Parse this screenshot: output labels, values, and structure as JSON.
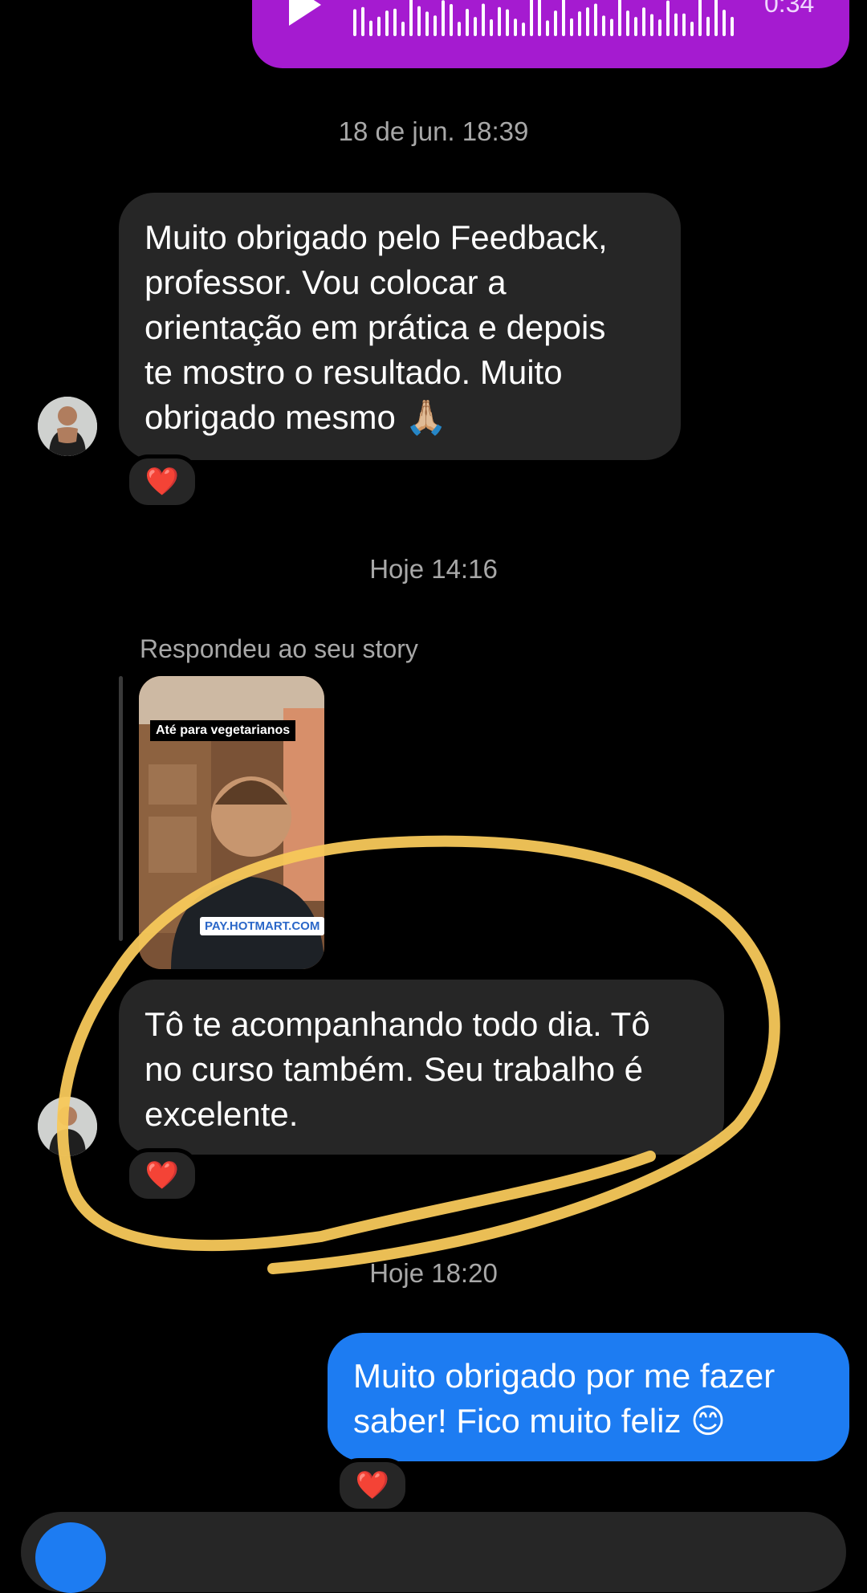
{
  "voice_message": {
    "duration": "0:34",
    "play_icon": "play-icon",
    "color": "#a51bd0"
  },
  "timestamps": {
    "t1": "18 de jun. 18:39",
    "t2": "Hoje 14:16",
    "t3": "Hoje 18:20"
  },
  "messages": {
    "m1": {
      "text": "Muito obrigado pelo Feedback,\nprofessor. Vou colocar a\norientação em prática e depois\nte mostro o resultado. Muito\nobrigado mesmo 🙏🏼",
      "reaction": "❤️"
    },
    "story_reply": {
      "label": "Respondeu ao seu story",
      "caption": "Até para vegetarianos",
      "link": "PAY.HOTMART.COM"
    },
    "m2": {
      "text": "Tô te acompanhando todo dia. Tô\nno curso também. Seu trabalho é\nexcelente.",
      "reaction": "❤️"
    },
    "m3": {
      "text": "Muito obrigado por me fazer\nsaber! Fico muito feliz 😊",
      "reaction": "❤️"
    }
  },
  "colors": {
    "incoming_bubble": "#262626",
    "outgoing_bubble": "#1d7cf2",
    "highlight": "#f7c85a",
    "reaction_heart": "#e8202f"
  }
}
